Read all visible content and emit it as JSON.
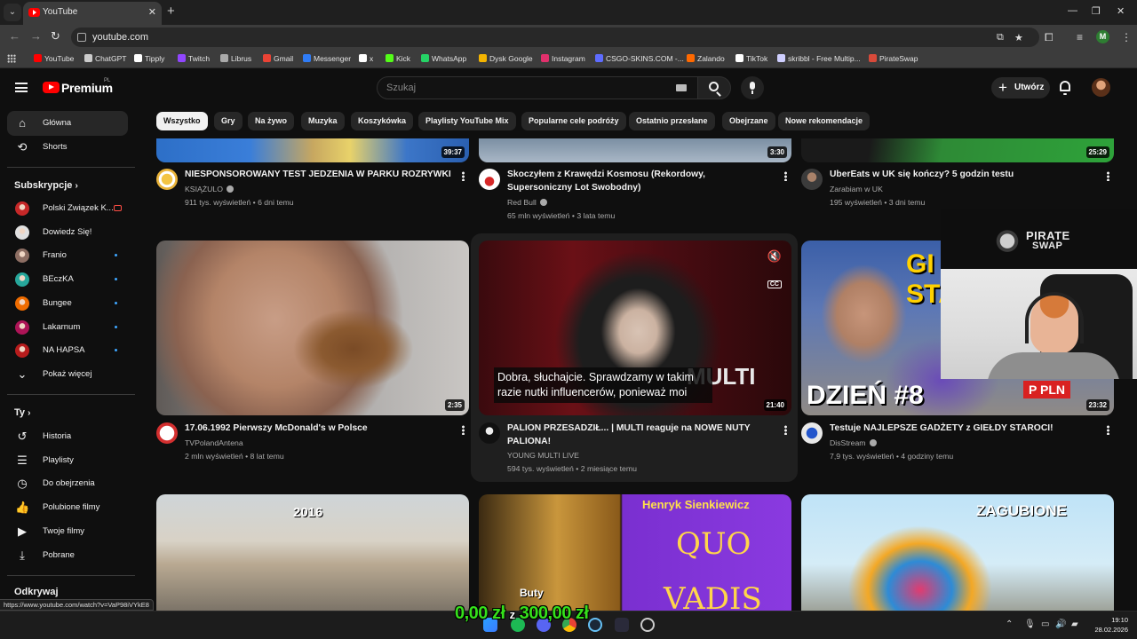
{
  "browser": {
    "tab_title": "YouTube",
    "url": "youtube.com",
    "profile_initial": "M",
    "bookmarks": [
      {
        "label": "YouTube",
        "color": "#ff0000"
      },
      {
        "label": "ChatGPT",
        "color": "#cccccc"
      },
      {
        "label": "Tipply",
        "color": "#ffffff"
      },
      {
        "label": "Twitch",
        "color": "#9146ff"
      },
      {
        "label": "Librus",
        "color": "#aaaaaa"
      },
      {
        "label": "Gmail",
        "color": "#ea4335"
      },
      {
        "label": "Messenger",
        "color": "#2f7cf6"
      },
      {
        "label": "x",
        "color": "#ffffff"
      },
      {
        "label": "Kick",
        "color": "#53fc18"
      },
      {
        "label": "WhatsApp",
        "color": "#25d366"
      },
      {
        "label": "Dysk Google",
        "color": "#f4b400"
      },
      {
        "label": "Instagram",
        "color": "#e1306c"
      },
      {
        "label": "CSGO-SKINS.COM -...",
        "color": "#5e6cff"
      },
      {
        "label": "Zalando",
        "color": "#ff6900"
      },
      {
        "label": "TikTok",
        "color": "#ffffff"
      },
      {
        "label": "skribbl - Free Multip...",
        "color": "#cfcfff"
      },
      {
        "label": "PirateSwap",
        "color": "#d84a3a"
      }
    ]
  },
  "header": {
    "brand": "Premium",
    "country": "PL",
    "search_placeholder": "Szukaj",
    "create_label": "Utwórz"
  },
  "sidebar": {
    "main": [
      {
        "label": "Główna",
        "icon": "home-icon"
      },
      {
        "label": "Shorts",
        "icon": "shorts-icon"
      }
    ],
    "subs_heading": "Subskrypcje",
    "subscriptions": [
      {
        "label": "Polski Związek K...",
        "color": "#c62828"
      },
      {
        "label": "Dowiedz Się!",
        "color": "#e0e0e0"
      },
      {
        "label": "Franio",
        "color": "#8d6e63"
      },
      {
        "label": "BEczKA",
        "color": "#26a69a"
      },
      {
        "label": "Bungee",
        "color": "#ef6c00"
      },
      {
        "label": "Lakarnum",
        "color": "#ad1457"
      },
      {
        "label": "NA HAPSA",
        "color": "#b71c1c"
      }
    ],
    "show_more": "Pokaż więcej",
    "you_heading": "Ty",
    "you_items": [
      {
        "label": "Historia",
        "icon": "history-icon"
      },
      {
        "label": "Playlisty",
        "icon": "playlists-icon"
      },
      {
        "label": "Do obejrzenia",
        "icon": "watch-later-icon"
      },
      {
        "label": "Polubione filmy",
        "icon": "liked-icon"
      },
      {
        "label": "Twoje filmy",
        "icon": "your-videos-icon"
      },
      {
        "label": "Pobrane",
        "icon": "downloads-icon"
      }
    ],
    "explore_heading": "Odkrywaj"
  },
  "chips": [
    "Wszystko",
    "Gry",
    "Na żywo",
    "Muzyka",
    "Koszykówka",
    "Playlisty YouTube Mix",
    "Popularne cele podróży",
    "Ostatnio przesłane",
    "Obejrzane",
    "Nowe rekomendacje"
  ],
  "videos_row1": [
    {
      "title": "NIESPONSOROWANY TEST JEDZENIA W PARKU ROZRYWKI",
      "channel": "KSIĄŻULO",
      "stats": "911 tys. wyświetleń • 6 dni temu",
      "duration": "39:37"
    },
    {
      "title": "Skoczyłem z Krawędzi Kosmosu (Rekordowy, Supersoniczny Lot Swobodny)",
      "channel": "Red Bull",
      "stats": "65 mln wyświetleń • 3 lata temu",
      "duration": "3:30"
    },
    {
      "title": "UberEats w UK się kończy? 5 godzin testu",
      "channel": "Zarabiam w UK",
      "stats": "195 wyświetleń • 3 dni temu",
      "duration": "25:29"
    }
  ],
  "videos_row2": [
    {
      "title": "17.06.1992 Pierwszy McDonald's w Polsce",
      "channel": "TVPolandAntena",
      "stats": "2 mln wyświetleń • 8 lat temu",
      "duration": "2:35"
    },
    {
      "title": "PALION PRZESADZIŁ... | MULTI reaguje na NOWE NUTY PALIONA!",
      "channel": "YOUNG MULTI LIVE",
      "stats": "594 tys. wyświetleń • 2 miesiące temu",
      "duration": "21:40",
      "caption": "Dobra, słuchajcie. Sprawdzamy w takim razie nutki influencerów, ponieważ moi",
      "thumb_text": "MULTI",
      "cc": "CC"
    },
    {
      "title": "Testuje NAJLEPSZE GADŻETY z GIEŁDY STAROCI!",
      "channel": "DisStream",
      "stats": "7,9 tys. wyświetleń • 4 godziny temu",
      "duration": "23:32",
      "thumb_text": "DZIEŃ #8",
      "thumb_top": "GI STA",
      "thumb_pln": "P PLN"
    }
  ],
  "videos_row3": [
    {
      "thumb_text": "2016"
    },
    {
      "thumb_top": "Henryk Sienkiewicz",
      "thumb_mid": "QUO",
      "thumb_bot": "VADIS",
      "thumb_small": "Buty"
    },
    {
      "thumb_text": "ZAGUBIONE"
    }
  ],
  "overlay": {
    "brand_line1": "PIRATE",
    "brand_line2": "SWAP",
    "balance_current": "0,00 zł",
    "balance_sep": "z",
    "balance_goal": "300,00 zł"
  },
  "status_url": "https://www.youtube.com/watch?v=VaP98iVYkE8",
  "clock": {
    "time": "19:10",
    "date": "28.02.2026"
  }
}
